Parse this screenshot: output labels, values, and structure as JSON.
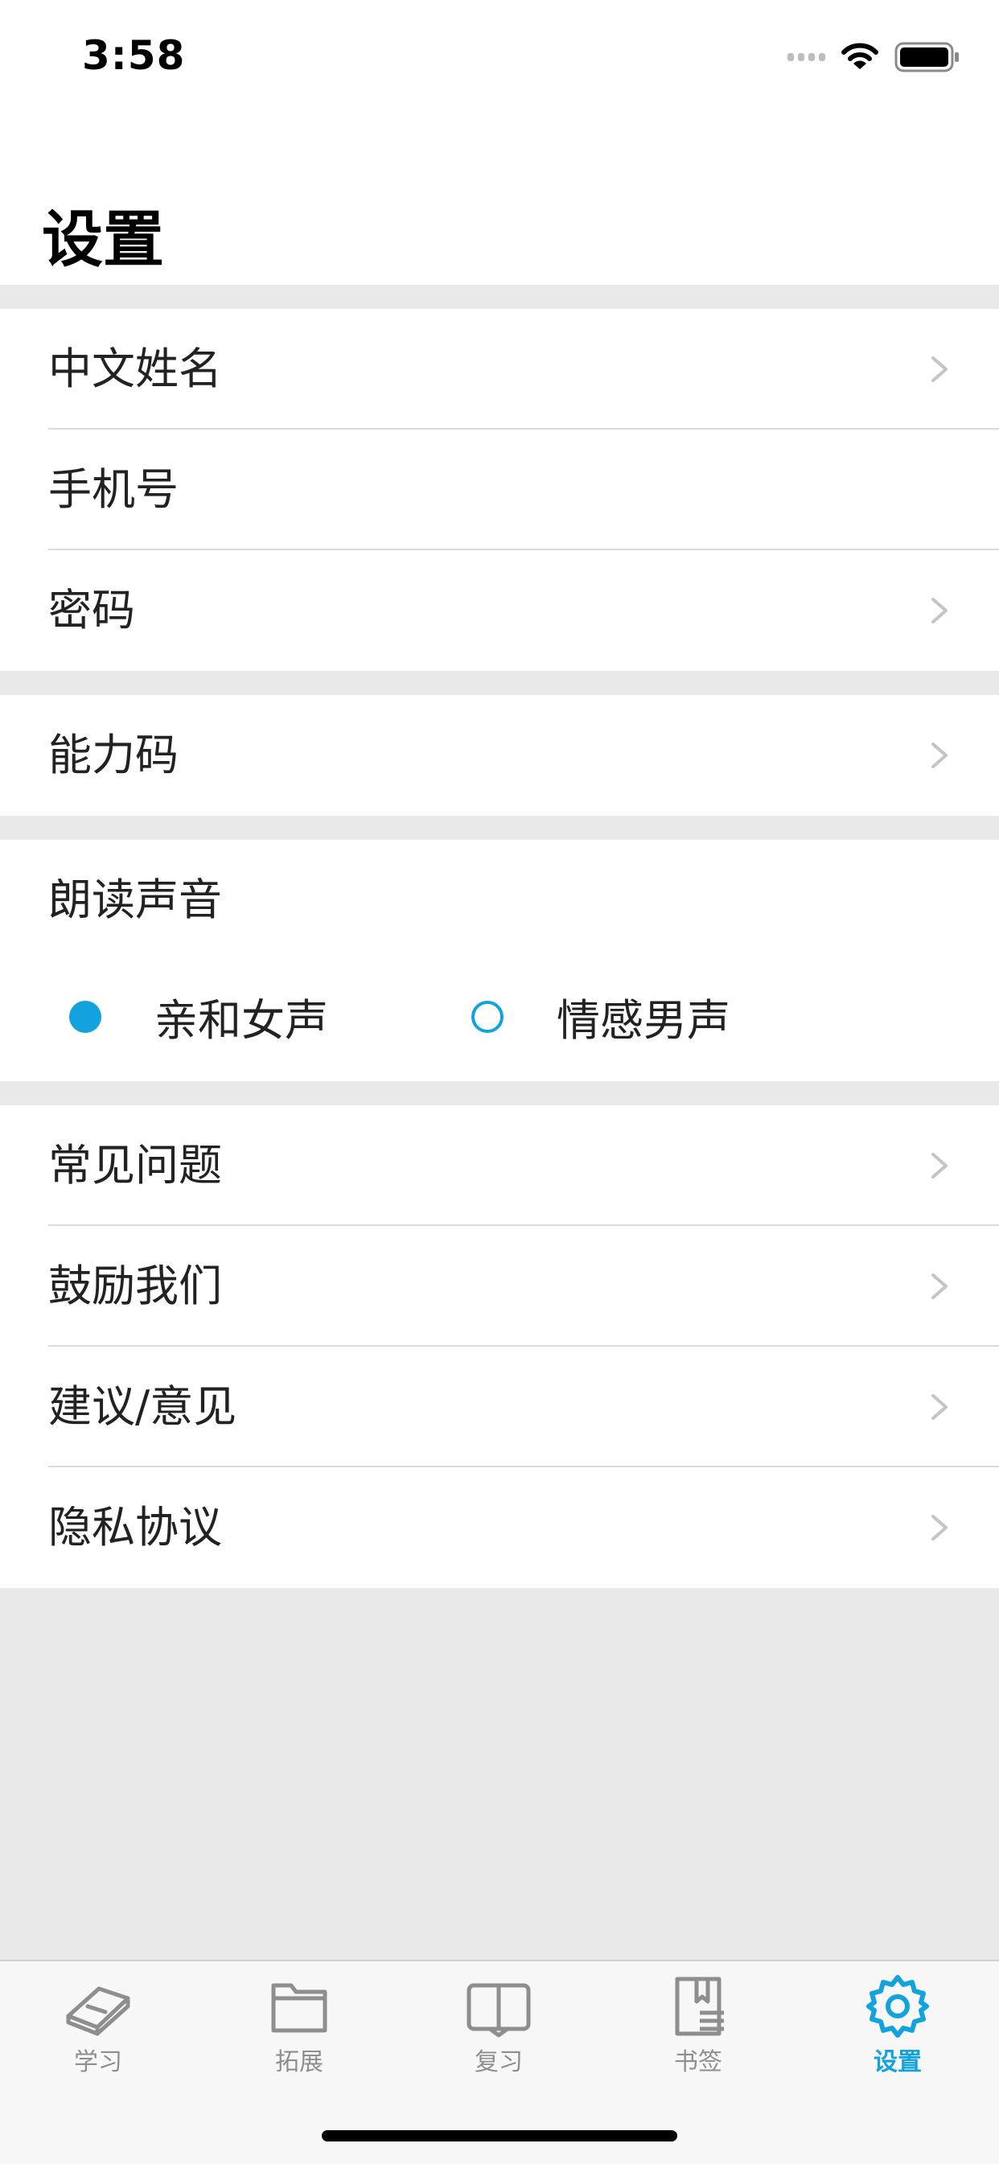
{
  "status_bar": {
    "time": "3:58"
  },
  "page": {
    "title": "设置"
  },
  "sections": {
    "account": [
      "中文姓名",
      "手机号",
      "密码"
    ],
    "ability": [
      "能力码"
    ],
    "voice": {
      "title": "朗读声音",
      "options": [
        {
          "label": "亲和女声",
          "selected": true
        },
        {
          "label": "情感男声",
          "selected": false
        }
      ]
    },
    "misc": [
      "常见问题",
      "鼓励我们",
      "建议/意见",
      "隐私协议"
    ]
  },
  "tabbar": {
    "tabs": [
      {
        "label": "学习",
        "icon": "notebook-icon"
      },
      {
        "label": "拓展",
        "icon": "folder-icon"
      },
      {
        "label": "复习",
        "icon": "open-book-icon"
      },
      {
        "label": "书签",
        "icon": "bookmark-icon"
      },
      {
        "label": "设置",
        "icon": "gear-icon",
        "active": true
      }
    ]
  },
  "colors": {
    "accent": "#12a3df",
    "background": "#e9e9ea",
    "divider": "#dcdcdc"
  }
}
